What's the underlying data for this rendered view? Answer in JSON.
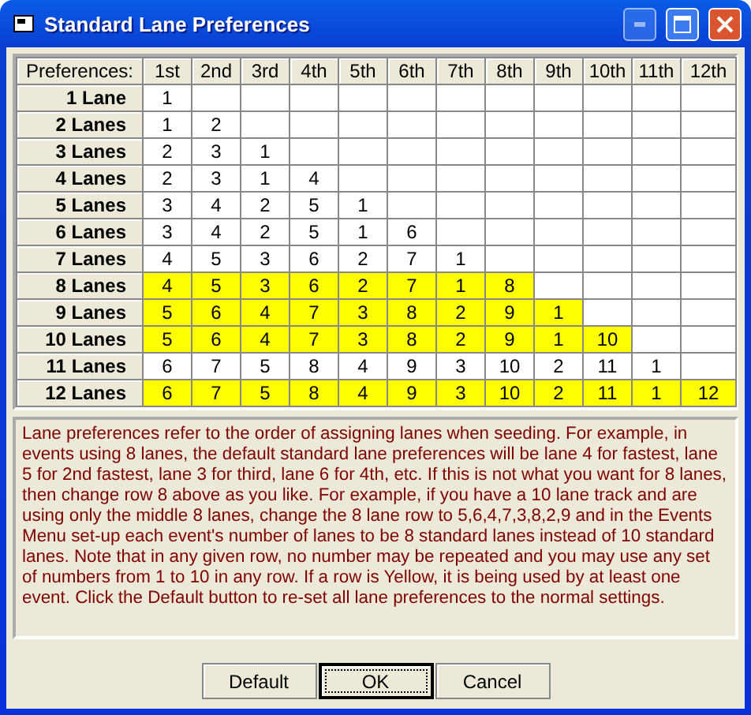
{
  "window": {
    "title": "Standard Lane Preferences"
  },
  "grid": {
    "corner": "Preferences:",
    "columns": [
      "1st",
      "2nd",
      "3rd",
      "4th",
      "5th",
      "6th",
      "7th",
      "8th",
      "9th",
      "10th",
      "11th",
      "12th"
    ],
    "rows": [
      {
        "label": "1 Lane",
        "highlighted": false,
        "cells": [
          "1"
        ]
      },
      {
        "label": "2 Lanes",
        "highlighted": false,
        "cells": [
          "1",
          "2"
        ]
      },
      {
        "label": "3 Lanes",
        "highlighted": false,
        "cells": [
          "2",
          "3",
          "1"
        ]
      },
      {
        "label": "4 Lanes",
        "highlighted": false,
        "cells": [
          "2",
          "3",
          "1",
          "4"
        ]
      },
      {
        "label": "5 Lanes",
        "highlighted": false,
        "cells": [
          "3",
          "4",
          "2",
          "5",
          "1"
        ]
      },
      {
        "label": "6 Lanes",
        "highlighted": false,
        "cells": [
          "3",
          "4",
          "2",
          "5",
          "1",
          "6"
        ]
      },
      {
        "label": "7 Lanes",
        "highlighted": false,
        "cells": [
          "4",
          "5",
          "3",
          "6",
          "2",
          "7",
          "1"
        ]
      },
      {
        "label": "8 Lanes",
        "highlighted": true,
        "cells": [
          "4",
          "5",
          "3",
          "6",
          "2",
          "7",
          "1",
          "8"
        ]
      },
      {
        "label": "9 Lanes",
        "highlighted": true,
        "cells": [
          "5",
          "6",
          "4",
          "7",
          "3",
          "8",
          "2",
          "9",
          "1"
        ]
      },
      {
        "label": "10 Lanes",
        "highlighted": true,
        "cells": [
          "5",
          "6",
          "4",
          "7",
          "3",
          "8",
          "2",
          "9",
          "1",
          "10"
        ]
      },
      {
        "label": "11 Lanes",
        "highlighted": false,
        "cells": [
          "6",
          "7",
          "5",
          "8",
          "4",
          "9",
          "3",
          "10",
          "2",
          "11",
          "1"
        ]
      },
      {
        "label": "12 Lanes",
        "highlighted": true,
        "cells": [
          "6",
          "7",
          "5",
          "8",
          "4",
          "9",
          "3",
          "10",
          "2",
          "11",
          "1",
          "12"
        ]
      }
    ]
  },
  "help_text": "Lane preferences refer to the order of assigning lanes when seeding.  For example, in events using 8 lanes, the default standard lane preferences will be lane 4 for fastest, lane 5 for 2nd fastest, lane 3 for third, lane 6 for 4th, etc.  If this is not what you want for 8 lanes, then change row 8 above as you like.  For example, if you have a 10 lane track and are using only the middle 8 lanes, change the 8 lane row to 5,6,4,7,3,8,2,9 and in the Events Menu set-up each event's number of lanes to be 8 standard lanes instead of 10 standard lanes.  Note that in any given row, no number may be repeated and you may use any set of numbers from 1 to 10 in any row.  If a row is Yellow, it is being used by at least one event.  Click the Default button to re-set all lane preferences to the normal settings.",
  "buttons": [
    {
      "label": "Default",
      "default": false
    },
    {
      "label": "OK",
      "default": true
    },
    {
      "label": "Cancel",
      "default": false
    }
  ]
}
